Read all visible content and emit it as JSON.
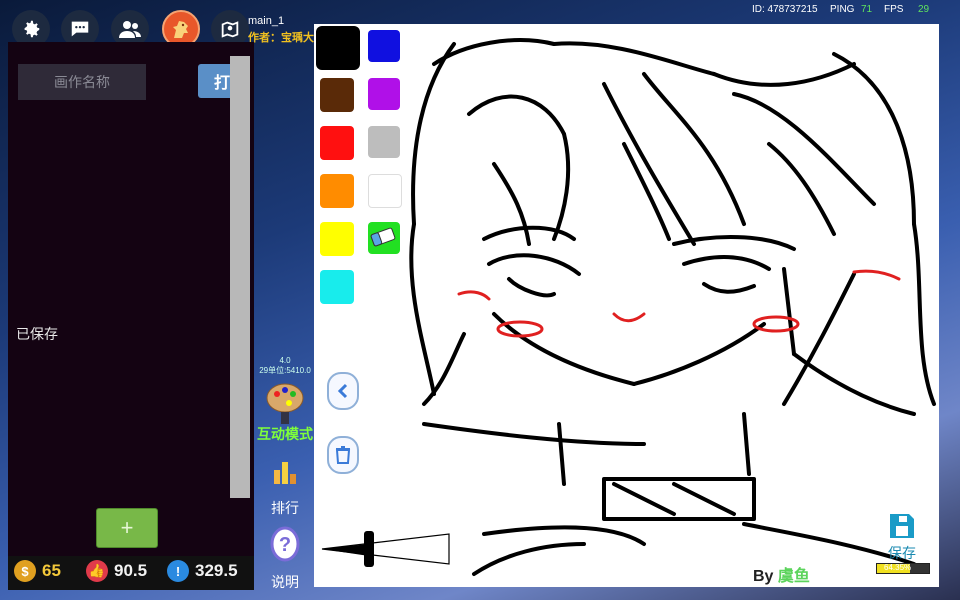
{
  "topbar": {
    "map_name": "main_1",
    "author_label": "作者：",
    "author_name": "宝瑀大",
    "id_text": "ID: 478737215",
    "ping_label": "PING",
    "ping_value": "71",
    "fps_label": "FPS",
    "fps_value": "29"
  },
  "left_panel": {
    "name_placeholder": "画作名称",
    "open_button_label": "打",
    "saved_label": "已保存",
    "add_button_label": "+"
  },
  "stats": {
    "coins": "65",
    "likes": "90.5",
    "alerts": "329.5"
  },
  "mid_column": {
    "small_text_1": "4.0 ",
    "small_text_2": "29单位:5410.0",
    "interactive_mode_label": "互动模式",
    "ranking_label": "排行",
    "help_label": "说明"
  },
  "palette": {
    "colors": [
      "#000000",
      "#1010e0",
      "#5a2a08",
      "#b010e8",
      "#ff1010",
      "#bdbdbd",
      "#ff8c00",
      "#ffffff",
      "#ffff00",
      "#22e022",
      "#18ecec"
    ]
  },
  "canvas": {
    "signature_prefix": "By",
    "signature_name": "虞鱼",
    "save_label": "保存",
    "save_progress_text": "64.35%",
    "save_progress": 0.6435
  }
}
